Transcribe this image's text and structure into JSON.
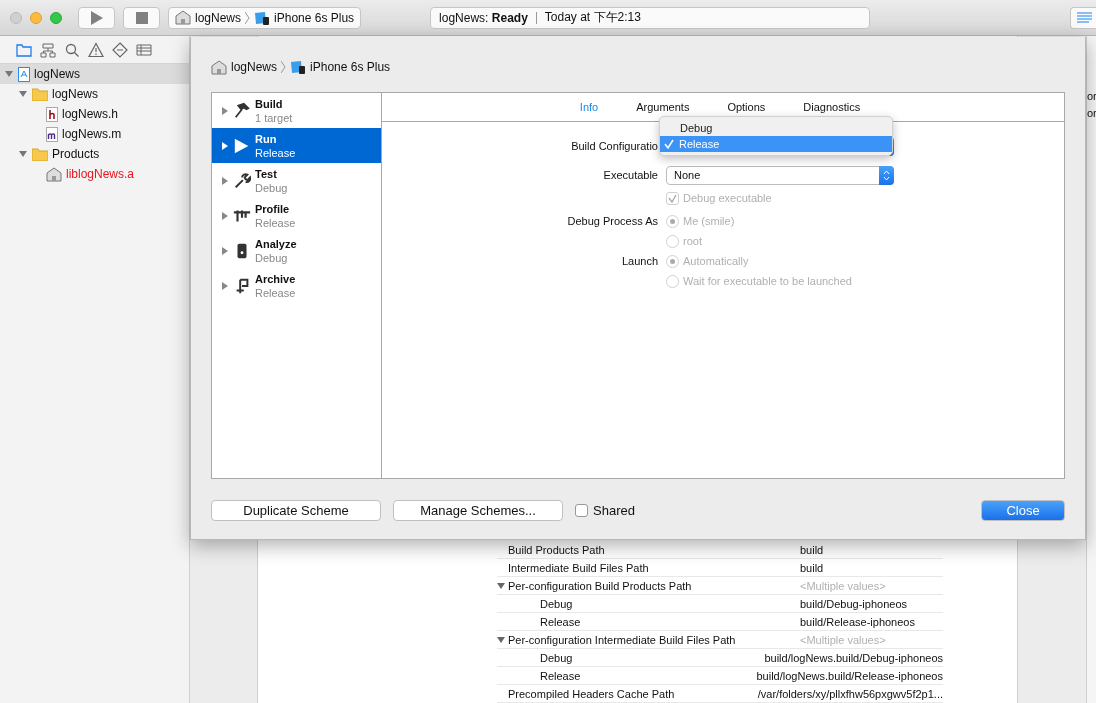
{
  "toolbar": {
    "scheme": {
      "project": "logNews",
      "device": "iPhone 6s Plus"
    },
    "activity": {
      "project": "logNews:",
      "status": "Ready",
      "time": "Today at 下午2:13"
    }
  },
  "navigator": {
    "tabs": [
      {
        "selected": true
      },
      {
        "selected": false
      },
      {
        "selected": false
      },
      {
        "selected": false
      },
      {
        "selected": false
      },
      {
        "selected": false
      }
    ],
    "tree": [
      {
        "name": "logNews",
        "kind": "project",
        "expanded": true,
        "selected": true,
        "children": [
          {
            "name": "logNews",
            "kind": "folder",
            "expanded": true,
            "selected": false,
            "children": [
              {
                "name": "logNews.h",
                "kind": "header",
                "selected": false
              },
              {
                "name": "logNews.m",
                "kind": "source",
                "selected": false
              }
            ]
          },
          {
            "name": "Products",
            "kind": "folder",
            "expanded": true,
            "selected": false,
            "children": [
              {
                "name": "liblogNews.a",
                "kind": "library",
                "missing": true,
                "selected": false
              }
            ]
          }
        ]
      }
    ]
  },
  "inspector_fragments": [
    "or",
    "or"
  ],
  "build_settings": [
    {
      "setting": "Build Products Path",
      "value": "build"
    },
    {
      "setting": "Intermediate Build Files Path",
      "value": "build"
    },
    {
      "setting": "Per-configuration Build Products Path",
      "value": "<Multiple values>",
      "muted": true,
      "expanded": true,
      "children": [
        {
          "setting": "Debug",
          "value": "build/Debug-iphoneos"
        },
        {
          "setting": "Release",
          "value": "build/Release-iphoneos"
        }
      ]
    },
    {
      "setting": "Per-configuration Intermediate Build Files Path",
      "value": "<Multiple values>",
      "muted": true,
      "expanded": true,
      "children": [
        {
          "setting": "Debug",
          "value": "build/logNews.build/Debug-iphoneos"
        },
        {
          "setting": "Release",
          "value": "build/logNews.build/Release-iphoneos"
        }
      ]
    },
    {
      "setting": "Precompiled Headers Cache Path",
      "value": "/var/folders/xy/pllxfhw56pxgwv5f2p1..."
    }
  ],
  "sheet": {
    "breadcrumb": {
      "project": "logNews",
      "device": "iPhone 6s Plus"
    },
    "actions": [
      {
        "kind": "build",
        "title": "Build",
        "subtitle": "1 target",
        "selected": false
      },
      {
        "kind": "run",
        "title": "Run",
        "subtitle": "Release",
        "selected": true
      },
      {
        "kind": "test",
        "title": "Test",
        "subtitle": "Debug",
        "selected": false
      },
      {
        "kind": "profile",
        "title": "Profile",
        "subtitle": "Release",
        "selected": false
      },
      {
        "kind": "analyze",
        "title": "Analyze",
        "subtitle": "Debug",
        "selected": false
      },
      {
        "kind": "archive",
        "title": "Archive",
        "subtitle": "Release",
        "selected": false
      }
    ],
    "tabs": [
      {
        "label": "Info",
        "selected": true
      },
      {
        "label": "Arguments",
        "selected": false
      },
      {
        "label": "Options",
        "selected": false
      },
      {
        "label": "Diagnostics",
        "selected": false
      }
    ],
    "build_configuration": {
      "label": "Build Configuratio",
      "menu": [
        {
          "label": "Debug",
          "selected": false
        },
        {
          "label": "Release",
          "selected": true
        }
      ]
    },
    "executable": {
      "label": "Executable",
      "value": "None"
    },
    "debug_executable": {
      "label": "Debug executable",
      "checked": true,
      "disabled": true
    },
    "debug_process_as": {
      "label": "Debug Process As",
      "disabled": true,
      "options": [
        {
          "label": "Me (smile)",
          "selected": true
        },
        {
          "label": "root",
          "selected": false
        }
      ]
    },
    "launch": {
      "label": "Launch",
      "disabled": true,
      "options": [
        {
          "label": "Automatically",
          "selected": true
        },
        {
          "label": "Wait for executable to be launched",
          "selected": false
        }
      ]
    },
    "buttons": {
      "duplicate": "Duplicate Scheme",
      "manage": "Manage Schemes...",
      "close": "Close"
    },
    "shared": {
      "label": "Shared",
      "checked": false
    }
  }
}
